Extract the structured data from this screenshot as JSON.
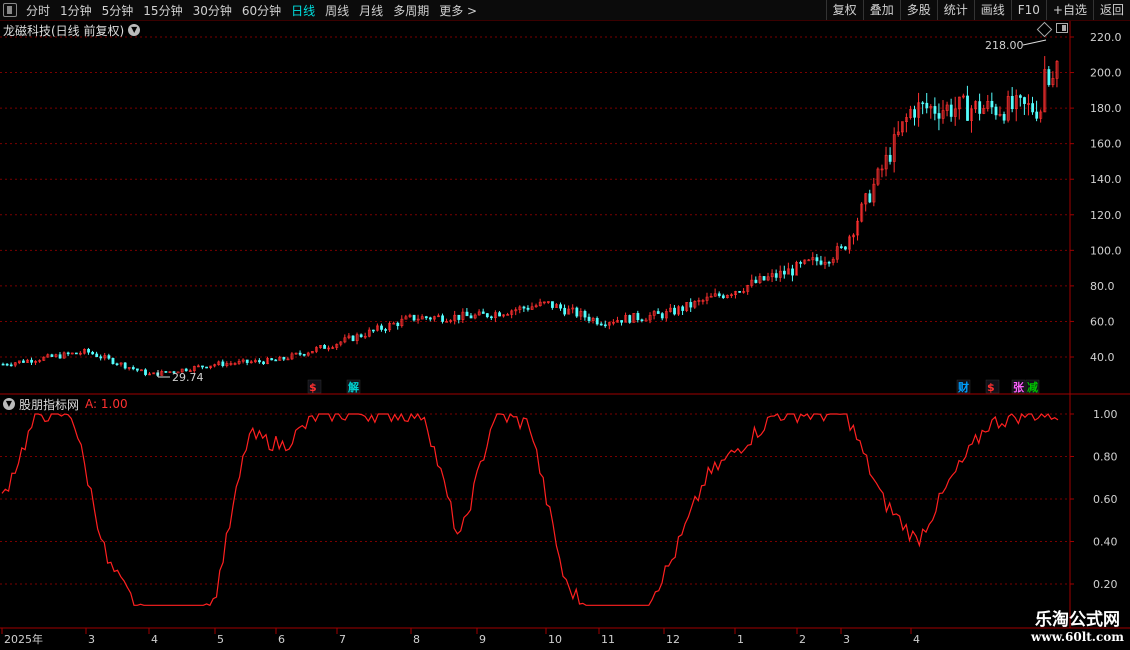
{
  "toolbar": {
    "tabs": [
      {
        "label": "分时"
      },
      {
        "label": "1分钟"
      },
      {
        "label": "5分钟"
      },
      {
        "label": "15分钟"
      },
      {
        "label": "30分钟"
      },
      {
        "label": "60分钟"
      },
      {
        "label": "日线"
      },
      {
        "label": "周线"
      },
      {
        "label": "月线"
      },
      {
        "label": "多周期"
      },
      {
        "label": "更多 >"
      }
    ],
    "active_tab": "日线",
    "right_tools": [
      {
        "label": "复权"
      },
      {
        "label": "叠加"
      },
      {
        "label": "多股"
      },
      {
        "label": "统计"
      },
      {
        "label": "画线"
      },
      {
        "label": "F10"
      },
      {
        "label": "+自选"
      },
      {
        "label": "返回"
      }
    ]
  },
  "main_chart": {
    "title": "龙磁科技(日线 前复权)",
    "high_label": "218.00",
    "low_label": "29.74",
    "y_ticks": [
      "220.0",
      "200.0",
      "180.0",
      "160.0",
      "140.0",
      "120.0",
      "100.0",
      "80.0",
      "60.0",
      "40.0"
    ],
    "event_markers": [
      {
        "label": "$",
        "color": "#ff3030"
      },
      {
        "label": "解",
        "color": "#00d0d0"
      },
      {
        "label": "财",
        "color": "#00a0ff"
      },
      {
        "label": "$",
        "color": "#ff3030"
      },
      {
        "label": "张",
        "color": "#ff60ff"
      },
      {
        "label": "减",
        "color": "#00c000"
      }
    ]
  },
  "indicator": {
    "title": "股朋指标网",
    "value_text": "A: 1.00",
    "y_ticks": [
      "1.00",
      "0.80",
      "0.60",
      "0.40",
      "0.20"
    ]
  },
  "time_axis": {
    "months": [
      "2025年",
      "3",
      "4",
      "5",
      "6",
      "7",
      "8",
      "9",
      "10",
      "11",
      "12",
      "1",
      "2",
      "3",
      "4"
    ]
  },
  "colors": {
    "up": "#ff3030",
    "down": "#54fcfc",
    "grid": "#7a0000",
    "indicator_line": "#ff2020",
    "axis_border": "#a00000"
  },
  "chart_data": {
    "type": "line",
    "price_series": {
      "name": "",
      "x": [
        "2025-02",
        "2025-03",
        "2025-04",
        "2025-05",
        "2025-06",
        "2025-07",
        "2025-08",
        "2025-09",
        "2025-10",
        "2025-11",
        "2025-12",
        "2026-01",
        "2026-02",
        "2026-03",
        "2026-04"
      ],
      "close": [
        36,
        43,
        30,
        36,
        38,
        48,
        62,
        63,
        70,
        60,
        64,
        78,
        90,
        100,
        180
      ],
      "high": 218.0,
      "low": 29.74,
      "ylim": [
        25,
        225
      ]
    },
    "indicator_series": {
      "name": "",
      "values": [
        0.6,
        1.0,
        1.0,
        0.3,
        0.05,
        0.05,
        0.1,
        0.9,
        0.85,
        1.0,
        1.0,
        1.0,
        1.0,
        0.4,
        1.0,
        0.95,
        0.2,
        0.02,
        0.02,
        0.3,
        0.7,
        0.85,
        1.0,
        1.0,
        1.0,
        0.6,
        0.4,
        0.7,
        0.95,
        1.0,
        1.0
      ],
      "ylim": [
        0.1,
        1.05
      ]
    }
  }
}
